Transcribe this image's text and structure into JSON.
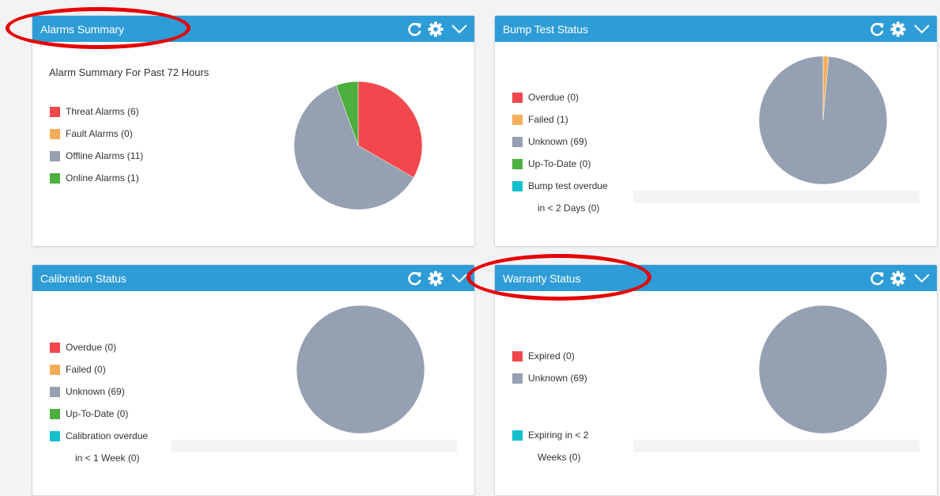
{
  "colors": {
    "header": "#2e9cd6",
    "red": "#f2474c",
    "orange": "#f5ad5a",
    "gray": "#95a0b2",
    "green": "#4caf3f",
    "cyan": "#12c1cc",
    "annotation": "#e60000"
  },
  "icons": {
    "refresh": "refresh-icon",
    "settings": "gear-icon",
    "collapse": "chevron-down-icon"
  },
  "panels": {
    "alarms": {
      "title": "Alarms Summary",
      "subtitle": "Alarm Summary For Past 72 Hours",
      "legend": [
        {
          "label": "Threat Alarms (6)",
          "color": "red",
          "value": 6
        },
        {
          "label": "Fault Alarms (0)",
          "color": "orange",
          "value": 0
        },
        {
          "label": "Offline Alarms (11)",
          "color": "gray",
          "value": 11
        },
        {
          "label": "Online Alarms (1)",
          "color": "green",
          "value": 1
        }
      ]
    },
    "bump": {
      "title": "Bump Test Status",
      "legend": [
        {
          "label": "Overdue (0)",
          "color": "red",
          "value": 0
        },
        {
          "label": "Failed (1)",
          "color": "orange",
          "value": 1
        },
        {
          "label": "Unknown (69)",
          "color": "gray",
          "value": 69
        },
        {
          "label": "Up-To-Date (0)",
          "color": "green",
          "value": 0
        },
        {
          "label": "Bump test overdue",
          "label2": "in < 2 Days (0)",
          "color": "cyan",
          "value": 0
        }
      ]
    },
    "calib": {
      "title": "Calibration Status",
      "legend": [
        {
          "label": "Overdue (0)",
          "color": "red",
          "value": 0
        },
        {
          "label": "Failed (0)",
          "color": "orange",
          "value": 0
        },
        {
          "label": "Unknown (69)",
          "color": "gray",
          "value": 69
        },
        {
          "label": "Up-To-Date (0)",
          "color": "green",
          "value": 0
        },
        {
          "label": "Calibration overdue",
          "label2": "in < 1 Week (0)",
          "color": "cyan",
          "value": 0
        }
      ]
    },
    "warranty": {
      "title": "Warranty Status",
      "legend": [
        {
          "label": "Expired (0)",
          "color": "red",
          "value": 0
        },
        {
          "label": "Unknown (69)",
          "color": "gray",
          "value": 69
        },
        {
          "label": "Expiring in < 2",
          "label2": "Weeks (0)",
          "color": "cyan",
          "value": 0
        }
      ]
    }
  }
}
